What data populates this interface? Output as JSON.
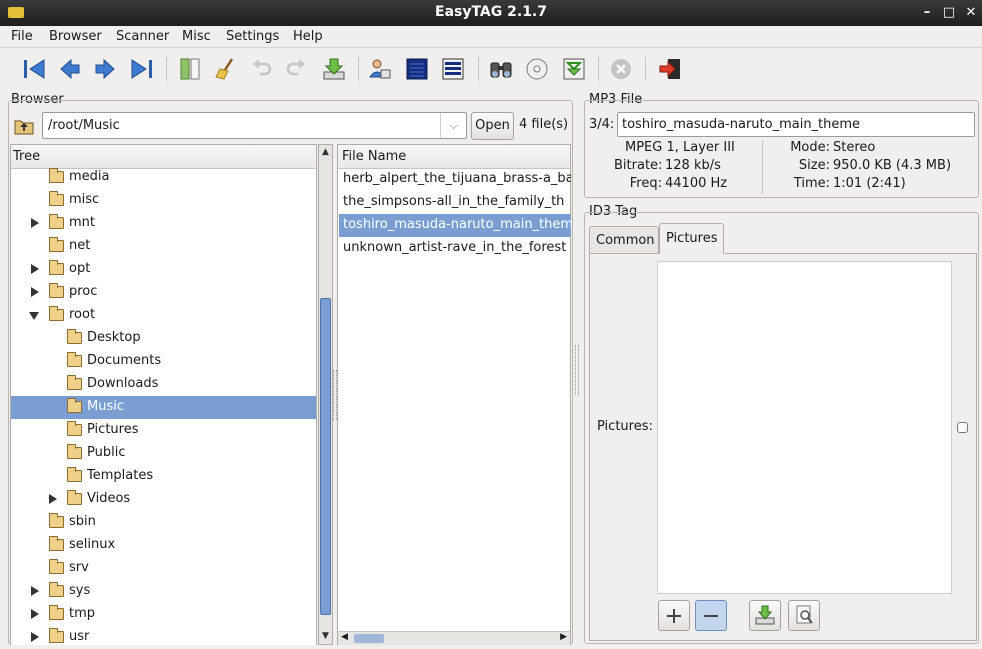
{
  "window": {
    "title": "EasyTAG 2.1.7"
  },
  "menu": [
    "File",
    "Browser",
    "Scanner",
    "Misc",
    "Settings",
    "Help"
  ],
  "toolbar": {
    "icons": [
      "first-file-icon",
      "previous-file-icon",
      "next-file-icon",
      "last-file-icon",
      "select-all-icon",
      "clear-icon",
      "undo-icon",
      "redo-icon",
      "save-icon",
      "edit-users-icon",
      "view-tree-icon",
      "view-list-icon",
      "search-icon",
      "cd-icon",
      "load-icon",
      "stop-icon",
      "quit-icon"
    ]
  },
  "browser": {
    "frame_label": "Browser",
    "path": "/root/Music",
    "open_label": "Open",
    "file_count": "4 file(s)",
    "tree_header": "Tree",
    "file_header": "File Name",
    "tree": [
      {
        "label": "media",
        "expander": "none"
      },
      {
        "label": "misc",
        "expander": "none"
      },
      {
        "label": "mnt",
        "expander": "closed"
      },
      {
        "label": "net",
        "expander": "none"
      },
      {
        "label": "opt",
        "expander": "closed"
      },
      {
        "label": "proc",
        "expander": "closed"
      },
      {
        "label": "root",
        "expander": "open"
      },
      {
        "label": "Desktop",
        "expander": "none"
      },
      {
        "label": "Documents",
        "expander": "none"
      },
      {
        "label": "Downloads",
        "expander": "none"
      },
      {
        "label": "Music",
        "expander": "none",
        "selected": true
      },
      {
        "label": "Pictures",
        "expander": "none"
      },
      {
        "label": "Public",
        "expander": "none"
      },
      {
        "label": "Templates",
        "expander": "none"
      },
      {
        "label": "Videos",
        "expander": "closed"
      },
      {
        "label": "sbin",
        "expander": "none"
      },
      {
        "label": "selinux",
        "expander": "none"
      },
      {
        "label": "srv",
        "expander": "none"
      },
      {
        "label": "sys",
        "expander": "closed"
      },
      {
        "label": "tmp",
        "expander": "closed"
      },
      {
        "label": "usr",
        "expander": "closed"
      }
    ],
    "files": [
      {
        "name": "herb_alpert_the_tijuana_brass-a_ba"
      },
      {
        "name": "the_simpsons-all_in_the_family_th"
      },
      {
        "name": "toshiro_masuda-naruto_main_them",
        "selected": true
      },
      {
        "name": "unknown_artist-rave_in_the_forest"
      }
    ]
  },
  "mp3": {
    "frame_label": "MP3 File",
    "index": "3/4:",
    "filename": "toshiro_masuda-naruto_main_theme",
    "format": "MPEG 1, Layer III",
    "bitrate_label": "Bitrate:",
    "bitrate": "128 kb/s",
    "freq_label": "Freq:",
    "freq": "44100 Hz",
    "mode_label": "Mode:",
    "mode": "Stereo",
    "size_label": "Size:",
    "size": "950.0 KB (4.3 MB)",
    "time_label": "Time:",
    "time": "1:01 (2:41)"
  },
  "id3": {
    "frame_label": "ID3 Tag",
    "tabs": [
      "Common",
      "Pictures"
    ],
    "active_tab": "Pictures",
    "pictures_label": "Pictures:"
  },
  "colors": {
    "selection": "#7b9ed2",
    "titlebar": "#2a2a2a"
  }
}
